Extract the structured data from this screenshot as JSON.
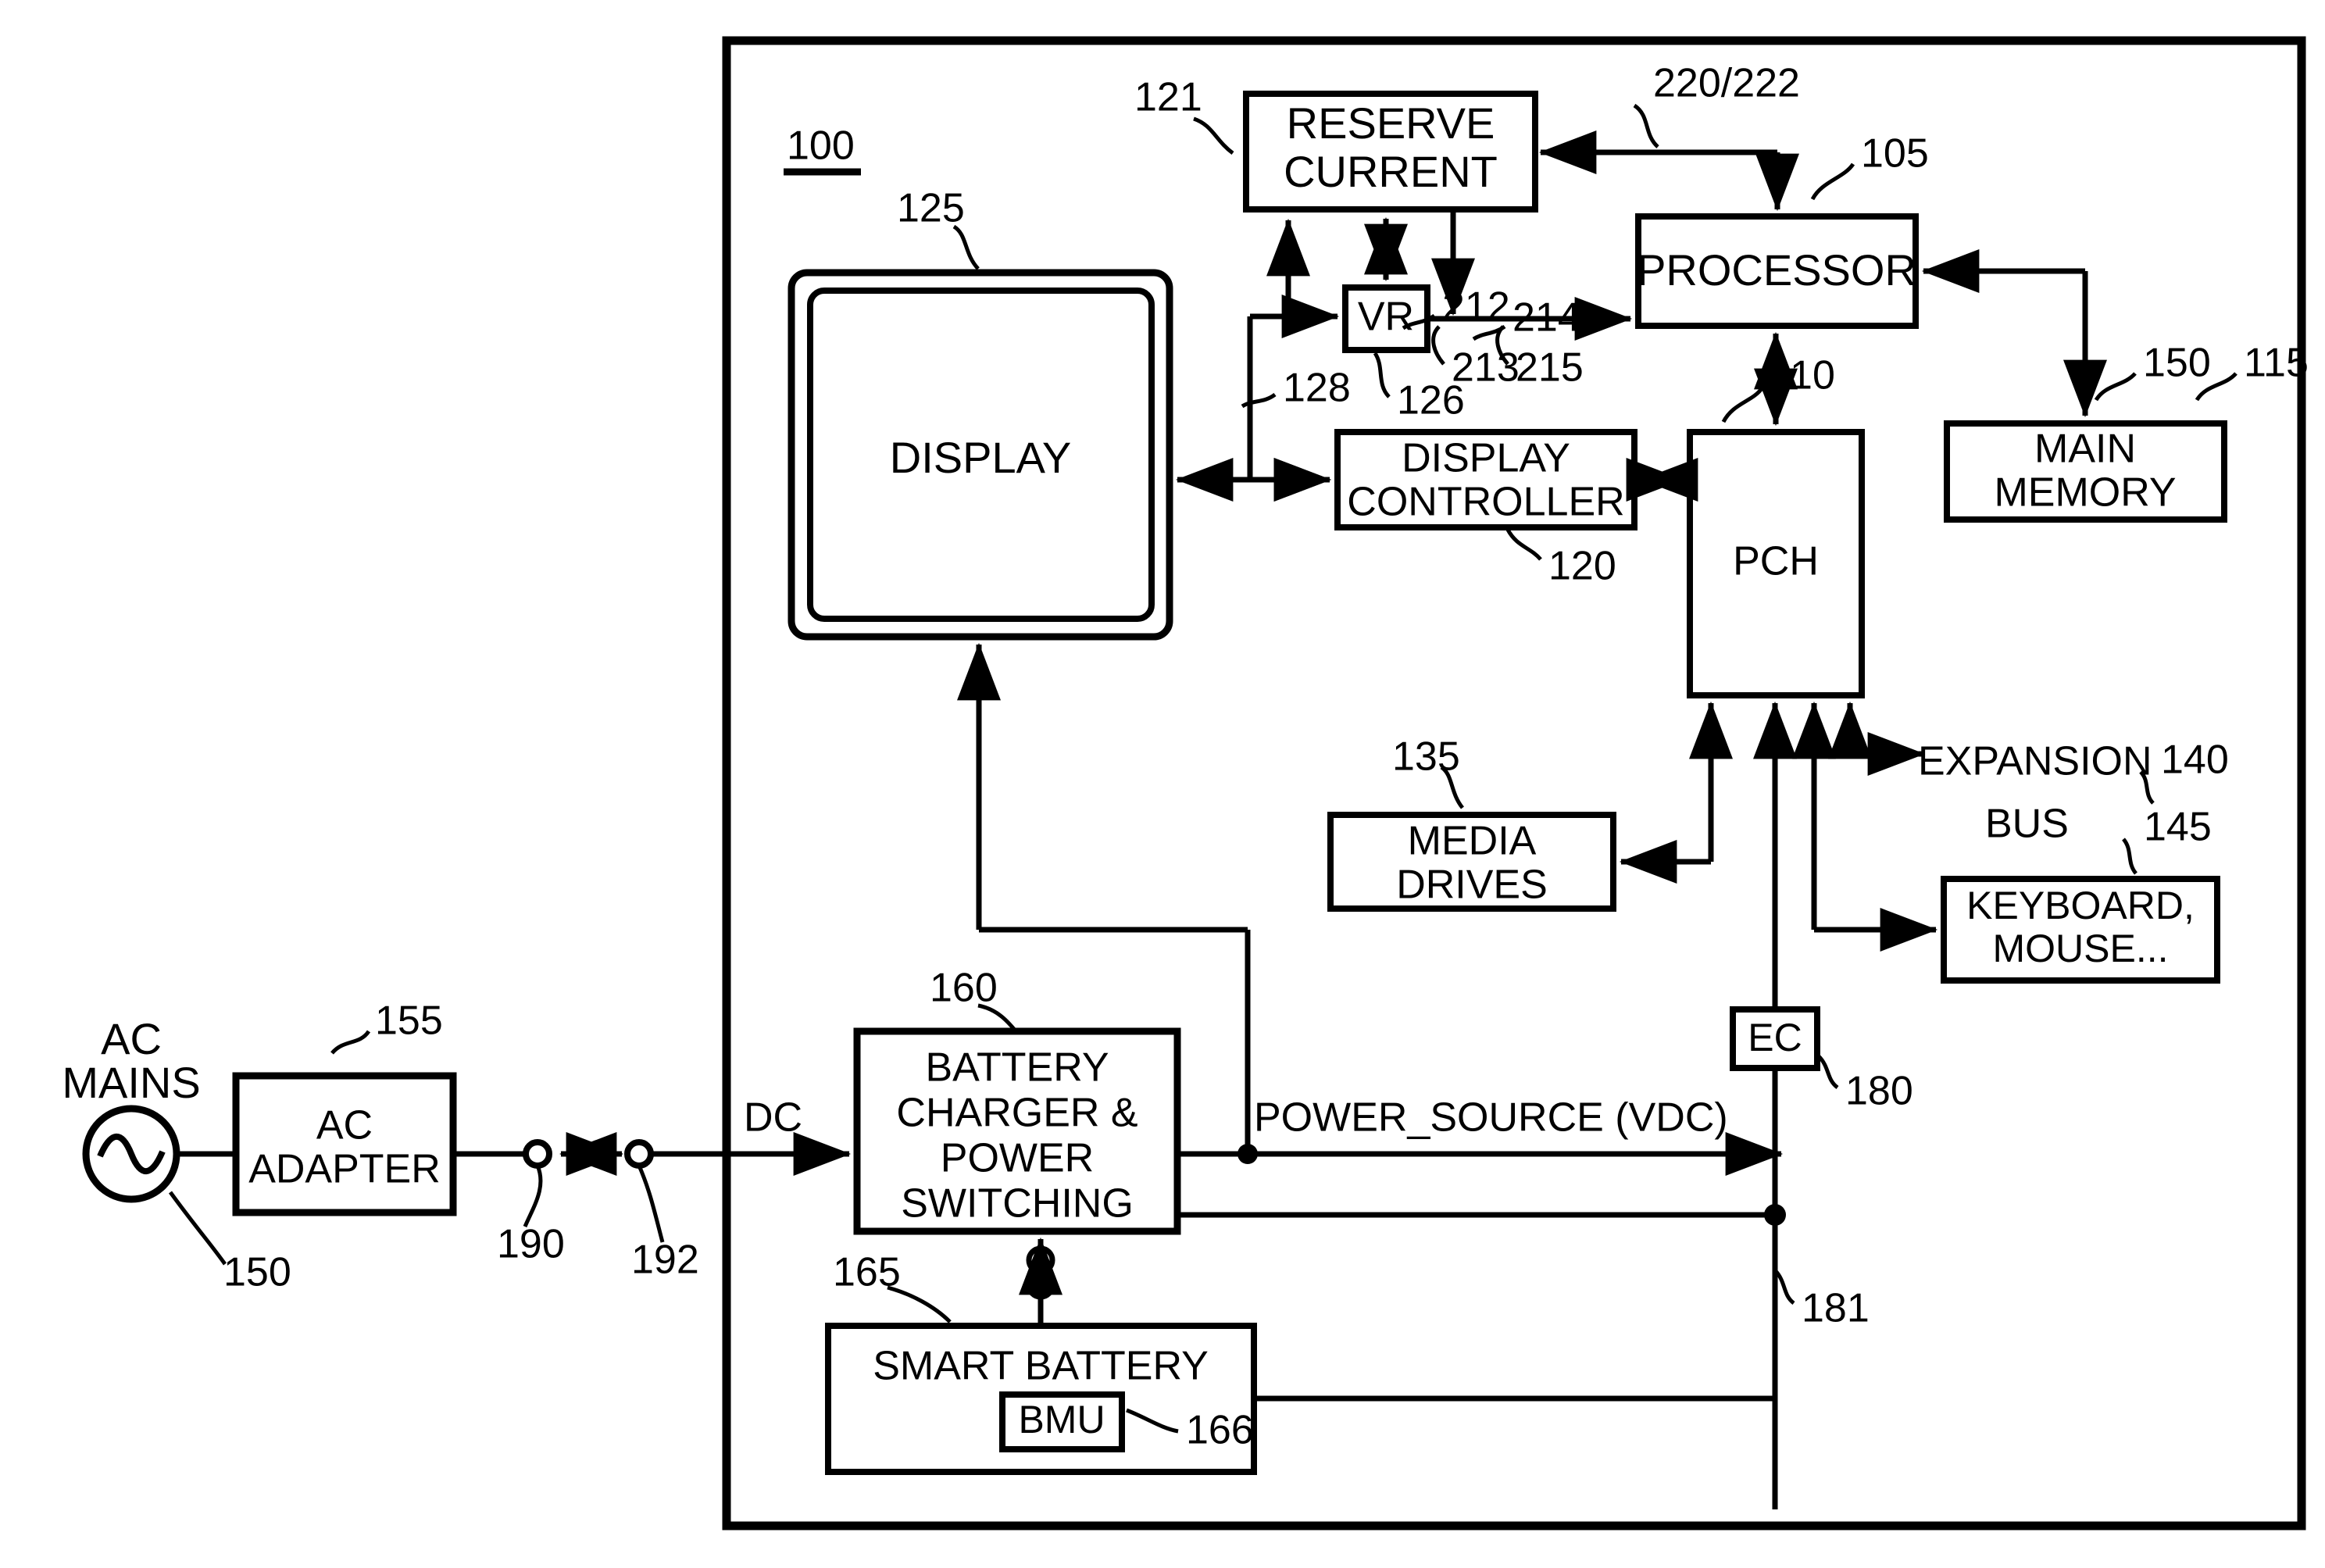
{
  "figure": {
    "type": "patent-block-diagram",
    "system_ref": "100"
  },
  "blocks": [
    {
      "id": "reserve-current",
      "label_line1": "RESERVE",
      "label_line2": "CURRENT",
      "ref": "121"
    },
    {
      "id": "processor",
      "label_line1": "PROCESSOR",
      "label_line2": "",
      "ref": "105"
    },
    {
      "id": "main-memory",
      "label_line1": "MAIN",
      "label_line2": "MEMORY",
      "ref": "115"
    },
    {
      "id": "vr",
      "label_line1": "VR",
      "label_line2": "",
      "ref": "126"
    },
    {
      "id": "display",
      "label_line1": "DISPLAY",
      "label_line2": "",
      "ref": "125"
    },
    {
      "id": "display-controller",
      "label_line1": "DISPLAY",
      "label_line2": "CONTROLLER",
      "ref": "120"
    },
    {
      "id": "pch",
      "label_line1": "PCH",
      "label_line2": "",
      "ref": "110"
    },
    {
      "id": "media-drives",
      "label_line1": "MEDIA",
      "label_line2": "DRIVES",
      "ref": "135"
    },
    {
      "id": "keyboard-mouse",
      "label_line1": "KEYBOARD,",
      "label_line2": "MOUSE...",
      "ref": "145"
    },
    {
      "id": "ac-adapter",
      "label_line1": "AC",
      "label_line2": "ADAPTER",
      "ref": "155"
    },
    {
      "id": "battery-charger",
      "label_line1": "BATTERY",
      "label_line2": "CHARGER &",
      "label_line3": "POWER",
      "label_line4": "SWITCHING",
      "ref": "160"
    },
    {
      "id": "smart-battery",
      "label_line1": "SMART BATTERY",
      "label_line2": "",
      "ref": "165"
    },
    {
      "id": "bmu",
      "label_line1": "BMU",
      "label_line2": "",
      "ref": "166"
    },
    {
      "id": "ec",
      "label_line1": "EC",
      "label_line2": "",
      "ref": "180"
    }
  ],
  "labels": {
    "system": "100",
    "ac_mains_line1": "AC",
    "ac_mains_line2": "MAINS",
    "ac_mains_ref": "150",
    "ac_adapter_ref": "155",
    "ac_adapter_l1": "AC",
    "ac_adapter_l2": "ADAPTER",
    "connector_190": "190",
    "connector_192": "192",
    "dc": "DC",
    "power_source": "POWER_SOURCE (VDC)",
    "battery_charger_ref": "160",
    "bc_l1": "BATTERY",
    "bc_l2": "CHARGER &",
    "bc_l3": "POWER",
    "bc_l4": "SWITCHING",
    "smart_battery": "SMART BATTERY",
    "smart_battery_ref": "165",
    "bmu": "BMU",
    "bmu_ref": "166",
    "ec": "EC",
    "ec_ref": "180",
    "ec_line_ref": "181",
    "reserve_l1": "RESERVE",
    "reserve_l2": "CURRENT",
    "reserve_ref": "121",
    "ref_220_222": "220/222",
    "processor": "PROCESSOR",
    "processor_ref": "105",
    "main_memory_l1": "MAIN",
    "main_memory_l2": "MEMORY",
    "main_memory_ref": "115",
    "memory_bus_ref": "150",
    "vr": "VR",
    "vr_ref": "126",
    "ref_212": "212",
    "ref_213": "213",
    "ref_214": "214",
    "ref_215": "215",
    "ref_128": "128",
    "display": "DISPLAY",
    "display_ref": "125",
    "display_controller_l1": "DISPLAY",
    "display_controller_l2": "CONTROLLER",
    "display_controller_ref": "120",
    "pch": "PCH",
    "pch_ref": "110",
    "media_l1": "MEDIA",
    "media_l2": "DRIVES",
    "media_ref": "135",
    "expansion_l1": "EXPANSION",
    "expansion_l2": "BUS",
    "expansion_ref": "140",
    "keyboard_l1": "KEYBOARD,",
    "keyboard_l2": "MOUSE...",
    "keyboard_ref": "145"
  },
  "colors": {
    "stroke": "#000000",
    "background": "#ffffff"
  }
}
